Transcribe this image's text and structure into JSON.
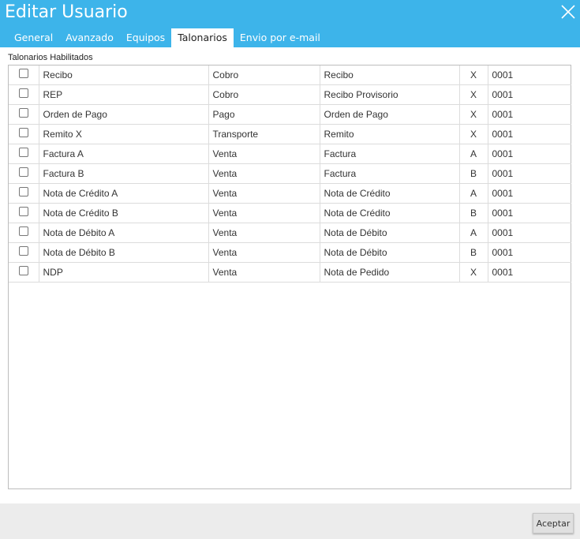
{
  "dialog": {
    "title": "Editar Usuario",
    "accent_color": "#3db4ea"
  },
  "tabs": [
    {
      "label": "General"
    },
    {
      "label": "Avanzado"
    },
    {
      "label": "Equipos"
    },
    {
      "label": "Talonarios",
      "active": true
    },
    {
      "label": "Envio por e-mail"
    }
  ],
  "section": {
    "label": "Talonarios Habilitados"
  },
  "rows": [
    {
      "checked": false,
      "name": "Recibo",
      "type": "Cobro",
      "document": "Recibo",
      "letter": "X",
      "number": "0001"
    },
    {
      "checked": false,
      "name": "REP",
      "type": "Cobro",
      "document": "Recibo Provisorio",
      "letter": "X",
      "number": "0001"
    },
    {
      "checked": false,
      "name": "Orden de Pago",
      "type": "Pago",
      "document": "Orden de Pago",
      "letter": "X",
      "number": "0001"
    },
    {
      "checked": false,
      "name": "Remito X",
      "type": "Transporte",
      "document": "Remito",
      "letter": "X",
      "number": "0001"
    },
    {
      "checked": false,
      "name": "Factura A",
      "type": "Venta",
      "document": "Factura",
      "letter": "A",
      "number": "0001"
    },
    {
      "checked": false,
      "name": "Factura B",
      "type": "Venta",
      "document": "Factura",
      "letter": "B",
      "number": "0001"
    },
    {
      "checked": false,
      "name": "Nota de Crédito A",
      "type": "Venta",
      "document": "Nota de Crédito",
      "letter": "A",
      "number": "0001"
    },
    {
      "checked": false,
      "name": "Nota de Crédito B",
      "type": "Venta",
      "document": "Nota de Crédito",
      "letter": "B",
      "number": "0001"
    },
    {
      "checked": false,
      "name": "Nota de Débito A",
      "type": "Venta",
      "document": "Nota de Débito",
      "letter": "A",
      "number": "0001"
    },
    {
      "checked": false,
      "name": "Nota de Débito B",
      "type": "Venta",
      "document": "Nota de Débito",
      "letter": "B",
      "number": "0001"
    },
    {
      "checked": false,
      "name": "NDP",
      "type": "Venta",
      "document": "Nota de Pedido",
      "letter": "X",
      "number": "0001"
    }
  ],
  "footer": {
    "accept_label": "Aceptar"
  }
}
